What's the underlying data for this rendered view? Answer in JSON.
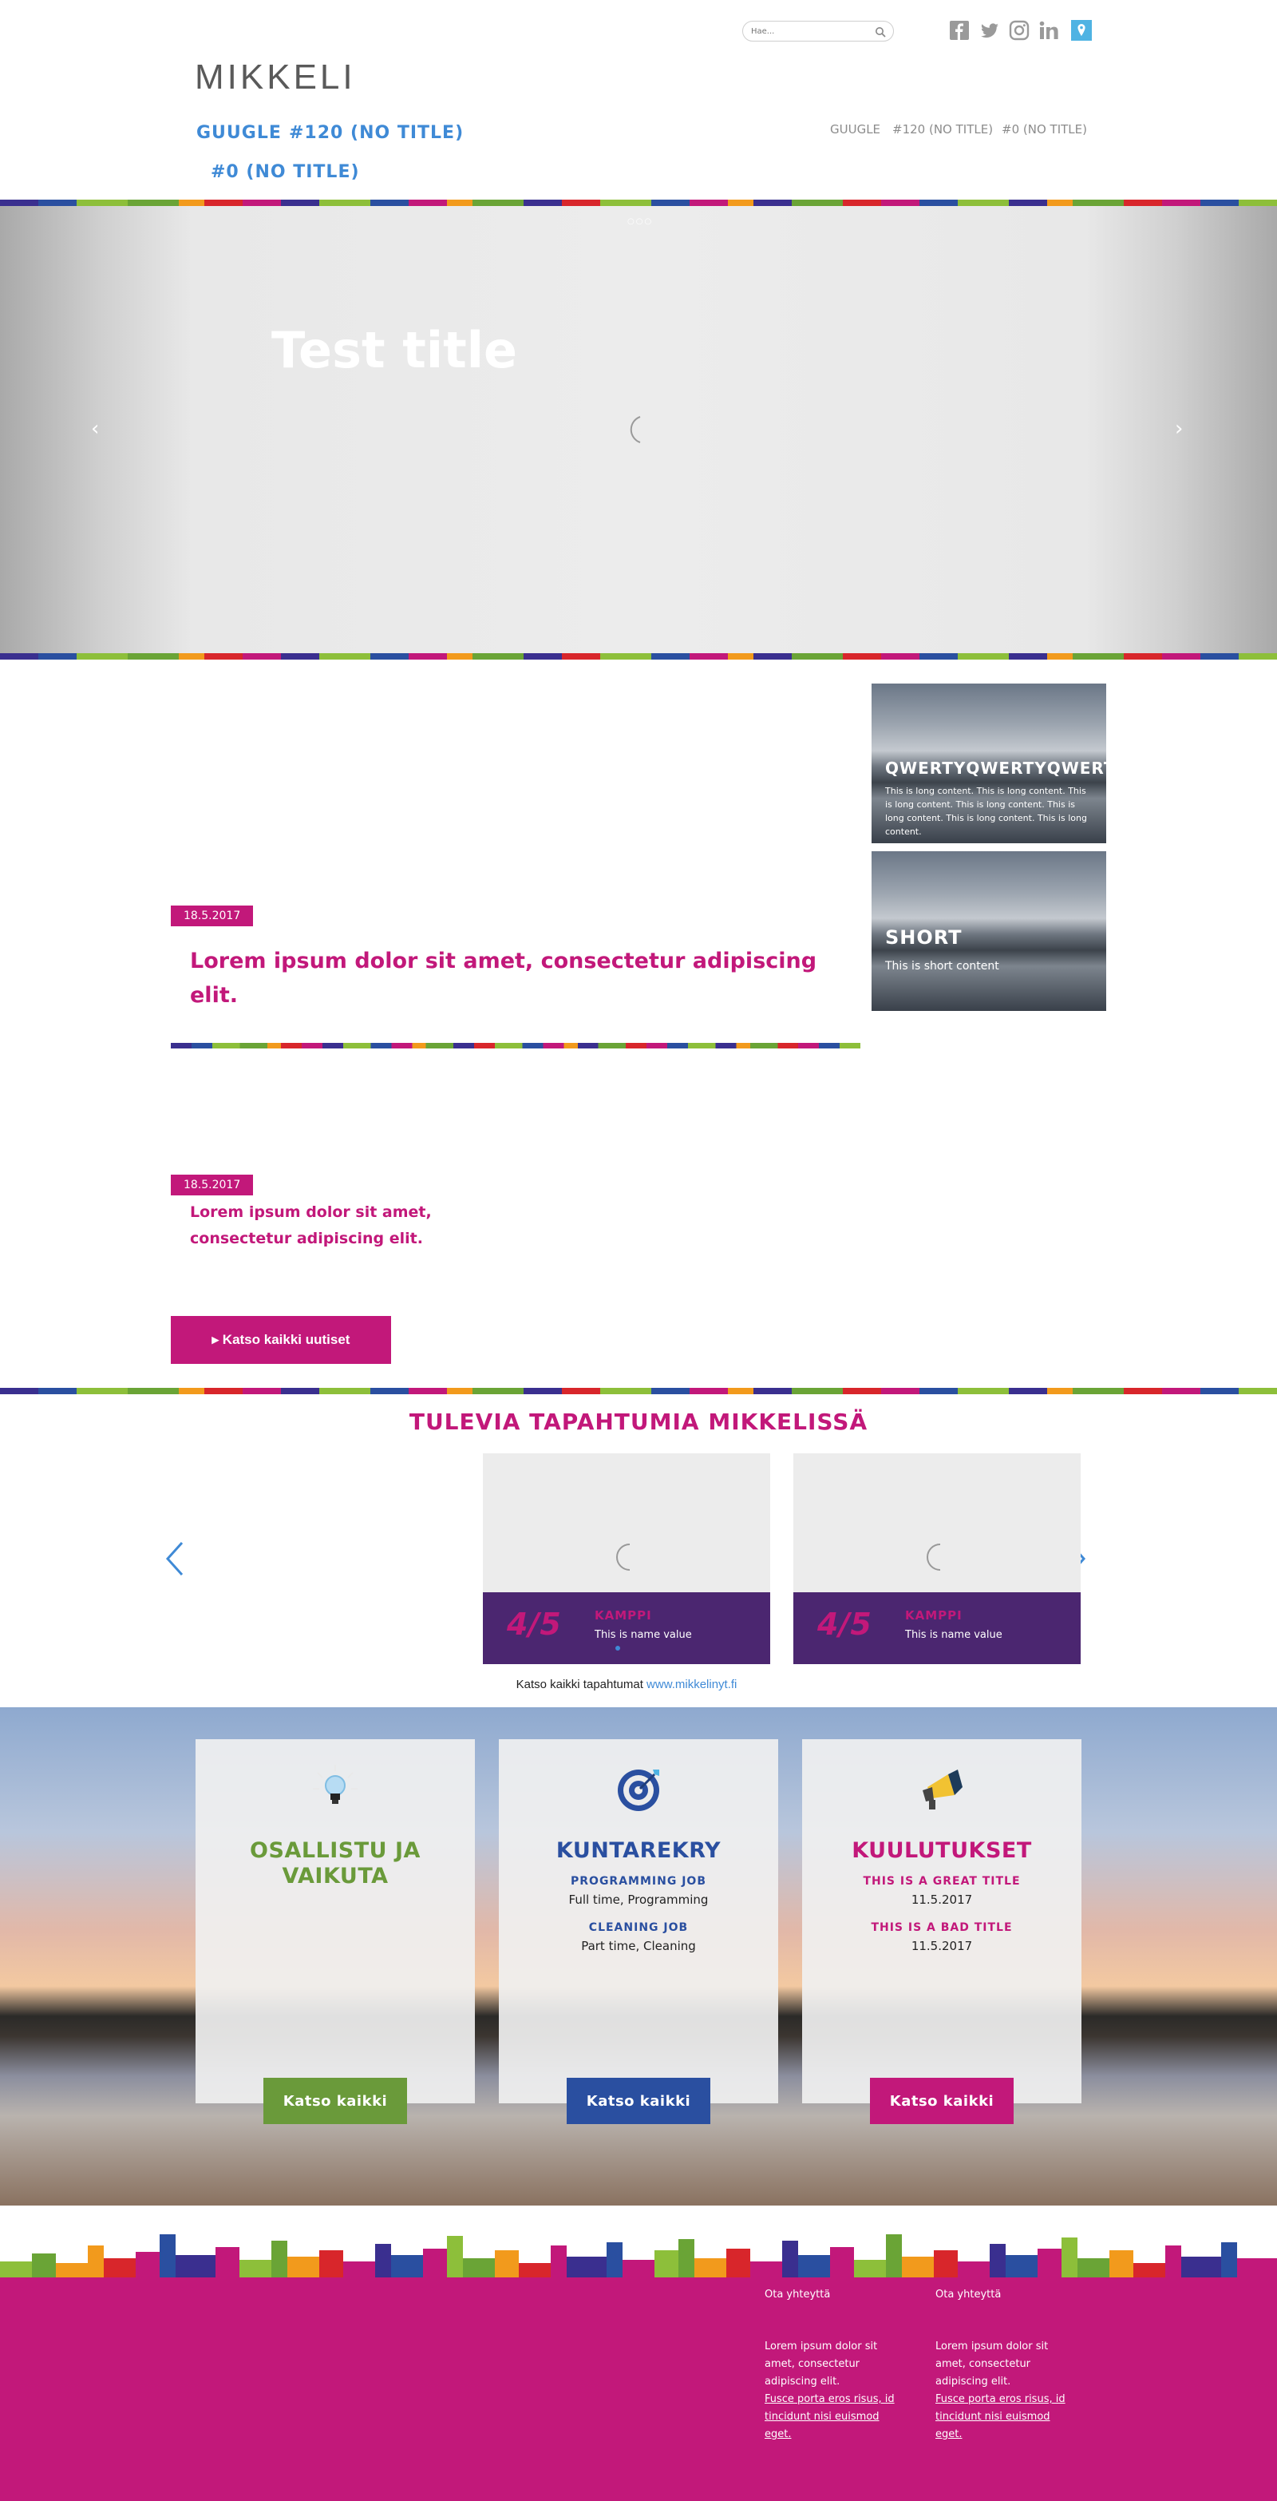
{
  "header": {
    "search_placeholder": "Hae...",
    "logo": "MIKKELI",
    "main_nav": [
      "GUUGLE",
      "#120 (NO TITLE)",
      "#0 (NO TITLE)"
    ],
    "top_nav": [
      "GUUGLE",
      "#120 (NO TITLE)",
      "#0 (NO TITLE)"
    ],
    "social_icons": [
      "facebook-icon",
      "twitter-icon",
      "instagram-icon",
      "linkedin-icon",
      "map-pin-icon"
    ]
  },
  "hero": {
    "indicator": "○○○",
    "title": "Test title",
    "prev_label": "‹",
    "next_label": "›"
  },
  "news": {
    "items": [
      {
        "date": "18.5.2017",
        "title": "Lorem ipsum dolor sit amet, consectetur adipiscing elit."
      },
      {
        "date": "18.5.2017",
        "title": "Lorem ipsum dolor sit amet, consectetur adipiscing elit."
      }
    ],
    "all_button": "▸ Katso kaikki uutiset",
    "side_cards": [
      {
        "title": "QWERTYQWERTYQWERTY",
        "text": "This is long content. This is long content. This is long content. This is long content. This is long content. This is long content. This is long content."
      },
      {
        "title": "SHORT",
        "text": "This is short content"
      }
    ]
  },
  "events": {
    "title": "TULEVIA TAPAHTUMIA MIKKELISSÄ",
    "cards": [
      {
        "date": "4/5",
        "place": "KAMPPI",
        "name": "This is name value"
      },
      {
        "date": "4/5",
        "place": "KAMPPI",
        "name": "This is name value"
      }
    ],
    "footer_text": "Katso kaikki tapahtumat ",
    "footer_link": "www.mikkelinyt.fi"
  },
  "services": [
    {
      "title": "OSALLISTU JA VAIKUTA",
      "color": "#6a9a3a",
      "icon": "lightbulb-icon",
      "items": [],
      "button": "Katso kaikki"
    },
    {
      "title": "KUNTAREKRY",
      "color": "#2a4fa0",
      "icon": "target-icon",
      "items": [
        {
          "heading": "PROGRAMMING JOB",
          "text": "Full time, Programming"
        },
        {
          "heading": "CLEANING JOB",
          "text": "Part time, Cleaning"
        }
      ],
      "button": "Katso kaikki"
    },
    {
      "title": "KUULUTUKSET",
      "color": "#c2187a",
      "icon": "megaphone-icon",
      "items": [
        {
          "heading": "THIS IS A GREAT TITLE",
          "text": "11.5.2017"
        },
        {
          "heading": "THIS IS A BAD TITLE",
          "text": "11.5.2017"
        }
      ],
      "button": "Katso kaikki"
    }
  ],
  "footer": {
    "columns": [
      {
        "heading": "Ota yhteyttä",
        "text": "Lorem ipsum dolor sit amet, consectetur adipiscing elit.",
        "link": "Fusce porta eros risus, id tincidunt nisi euismod eget."
      },
      {
        "heading": "Ota yhteyttä",
        "text": "Lorem ipsum dolor sit amet, consectetur adipiscing elit.",
        "link": "Fusce porta eros risus, id tincidunt nisi euismod eget."
      }
    ]
  },
  "colors": {
    "magenta": "#c2187a",
    "purple": "#4b2670",
    "blue": "#3f8ad6",
    "green": "#6a9a3a",
    "navy": "#2a4fa0"
  }
}
